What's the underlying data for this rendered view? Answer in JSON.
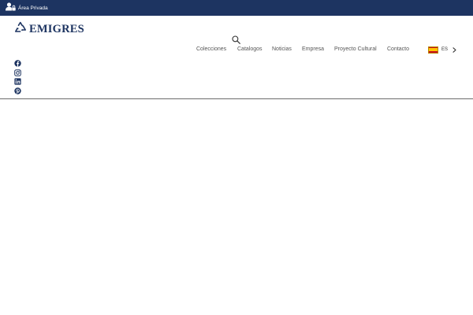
{
  "topbar": {
    "private_area": {
      "icon": "user-lock-icon",
      "label": "Área Privada"
    },
    "background": "#1d3461"
  },
  "header": {
    "logo": {
      "icon": "recycle-logo-icon",
      "text": "EMIGRES"
    },
    "search": {
      "icon": "search-icon"
    },
    "nav": [
      {
        "label": "Colecciones"
      },
      {
        "label": "Catalogos"
      },
      {
        "label": "Noticias"
      },
      {
        "label": "Empresa"
      },
      {
        "label": "Proyecto Cultural"
      },
      {
        "label": "Contacto"
      }
    ],
    "language": {
      "flag": "spain-flag-icon",
      "code": "ES",
      "chevron": "chevron-right-icon"
    }
  },
  "social": [
    {
      "icon": "facebook-icon"
    },
    {
      "icon": "instagram-icon"
    },
    {
      "icon": "linkedin-icon"
    },
    {
      "icon": "pinterest-icon"
    }
  ],
  "colors": {
    "brand": "#1d3461",
    "nav_text": "#555555",
    "divider": "#6b6b6b"
  }
}
